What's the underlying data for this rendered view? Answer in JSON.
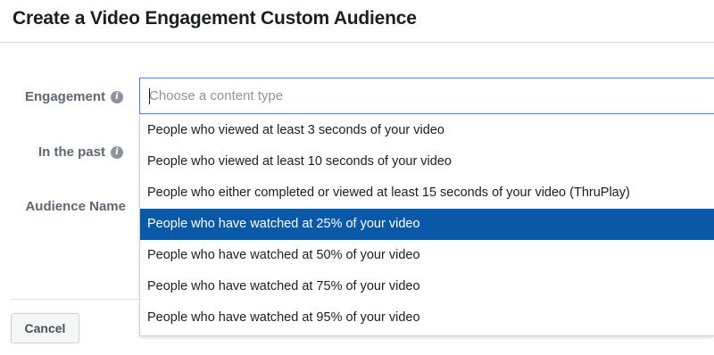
{
  "dialog": {
    "title": "Create a Video Engagement Custom Audience"
  },
  "form": {
    "engagement_label": "Engagement",
    "in_the_past_label": "In the past",
    "audience_name_label": "Audience Name",
    "info_glyph": "i"
  },
  "content_type_select": {
    "placeholder": "Choose a content type",
    "value": ""
  },
  "dropdown": {
    "selected_index": 3,
    "options": [
      "People who viewed at least 3 seconds of your video",
      "People who viewed at least 10 seconds of your video",
      "People who either completed or viewed at least 15 seconds of your video (ThruPlay)",
      "People who have watched at 25% of your video",
      "People who have watched at 50% of your video",
      "People who have watched at 75% of your video",
      "People who have watched at 95% of your video"
    ]
  },
  "footer": {
    "cancel_label": "Cancel"
  },
  "colors": {
    "selected_option_bg": "#0a59a8",
    "focus_border": "#4080ff",
    "label_text": "#606770"
  }
}
